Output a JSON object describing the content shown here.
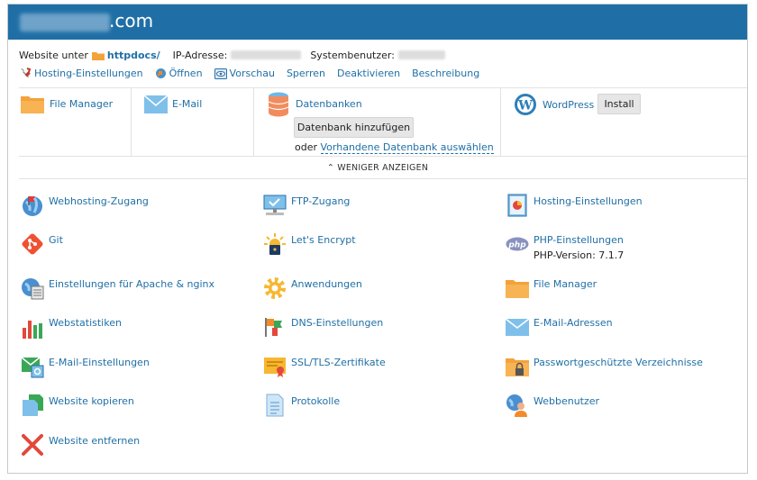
{
  "header": {
    "domain_suffix": ".com"
  },
  "info": {
    "website_label": "Website unter",
    "httpdocs": "httpdocs/",
    "ip_label": "IP-Adresse:",
    "sysuser_label": "Systembenutzer:"
  },
  "actions": [
    {
      "label": "Hosting-Einstellungen",
      "icon": "wrench-icon"
    },
    {
      "label": "Öffnen",
      "icon": "globe-arrow-icon"
    },
    {
      "label": "Vorschau",
      "icon": "eye-icon"
    },
    {
      "label": "Sperren",
      "icon": ""
    },
    {
      "label": "Deaktivieren",
      "icon": ""
    },
    {
      "label": "Beschreibung",
      "icon": ""
    }
  ],
  "tiles": {
    "file_manager": "File Manager",
    "email": "E-Mail",
    "databases": "Datenbanken",
    "add_db": "Datenbank hinzufügen",
    "or": "oder",
    "select_db": "Vorhandene Datenbank auswählen",
    "wordpress": "WordPress",
    "install": "Install"
  },
  "less_label": "WENIGER ANZEIGEN",
  "grid": [
    {
      "label": "Webhosting-Zugang",
      "icon": "globe-flag-icon"
    },
    {
      "label": "FTP-Zugang",
      "icon": "ftp-icon"
    },
    {
      "label": "Hosting-Einstellungen",
      "icon": "hosting-settings-icon"
    },
    {
      "label": "Git",
      "icon": "git-icon"
    },
    {
      "label": "Let's Encrypt",
      "icon": "lets-encrypt-icon"
    },
    {
      "label": "PHP-Einstellungen",
      "icon": "php-icon",
      "sub": "PHP-Version: 7.1.7"
    },
    {
      "label": "Einstellungen für Apache & nginx",
      "icon": "apache-nginx-icon"
    },
    {
      "label": "Anwendungen",
      "icon": "gear-icon"
    },
    {
      "label": "File Manager",
      "icon": "folder-icon"
    },
    {
      "label": "Webstatistiken",
      "icon": "bar-chart-icon"
    },
    {
      "label": "DNS-Einstellungen",
      "icon": "dns-icon"
    },
    {
      "label": "E-Mail-Adressen",
      "icon": "envelope-icon"
    },
    {
      "label": "E-Mail-Einstellungen",
      "icon": "mail-settings-icon"
    },
    {
      "label": "SSL/TLS-Zertifikate",
      "icon": "certificate-icon"
    },
    {
      "label": "Passwortgeschützte Verzeichnisse",
      "icon": "locked-folder-icon"
    },
    {
      "label": "Website kopieren",
      "icon": "copy-icon"
    },
    {
      "label": "Protokolle",
      "icon": "logs-icon"
    },
    {
      "label": "Webbenutzer",
      "icon": "web-user-icon"
    },
    {
      "label": "Website entfernen",
      "icon": "remove-icon"
    }
  ]
}
